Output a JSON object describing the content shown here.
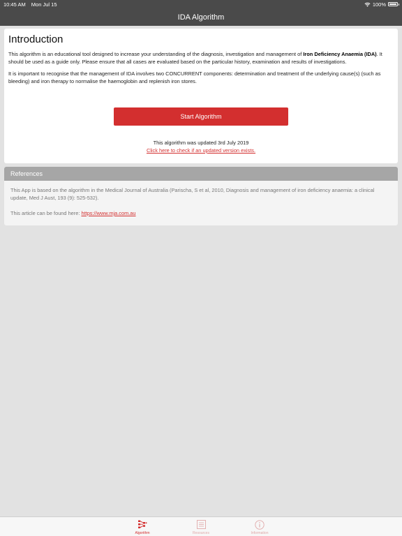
{
  "status": {
    "time": "10:45 AM",
    "date": "Mon Jul 15",
    "battery": "100%",
    "battery_level": 1.0
  },
  "nav": {
    "title": "IDA Algorithm"
  },
  "intro": {
    "heading": "Introduction",
    "p1_pre": "This algorithm is an educational tool designed to increase your understanding of the diagnosis, investigation and management of ",
    "p1_bold": "Iron Deficiency Anaemia (IDA)",
    "p1_post": ". It should be used as a guide only. Please ensure that all cases are evaluated based on the particular history, examination and results of investigations.",
    "p2": "It is important to recognise that the management of IDA involves two CONCURRENT components: determination and treatment of the underlying cause(s) (such as bleeding) and iron therapy to normalise the haemoglobin and replenish iron stores.",
    "start_button": "Start Algorithm",
    "updated": "This algorithm was updated 3rd July 2019",
    "check_link": "Click here to check if an updated version exists."
  },
  "references": {
    "header": "References",
    "text": "This App is based on the algorithm in the Medical Journal of Australia (Parischa, S et al, 2010, Diagnosis and management of iron deficiency anaemia: a clinical update, Med J Aust, 193 (9): 525-532).",
    "article_prefix": "This article can be found here: ",
    "article_link": "https://www.mja.com.au"
  },
  "tabs": [
    {
      "label": "Algorithm",
      "icon": "algorithm-icon",
      "active": true
    },
    {
      "label": "Resources",
      "icon": "resources-icon",
      "active": false
    },
    {
      "label": "Information",
      "icon": "information-icon",
      "active": false
    }
  ],
  "colors": {
    "accent": "#d32f2f",
    "bar": "#4a4a4a",
    "inactive_tab": "#e0a8a8"
  }
}
